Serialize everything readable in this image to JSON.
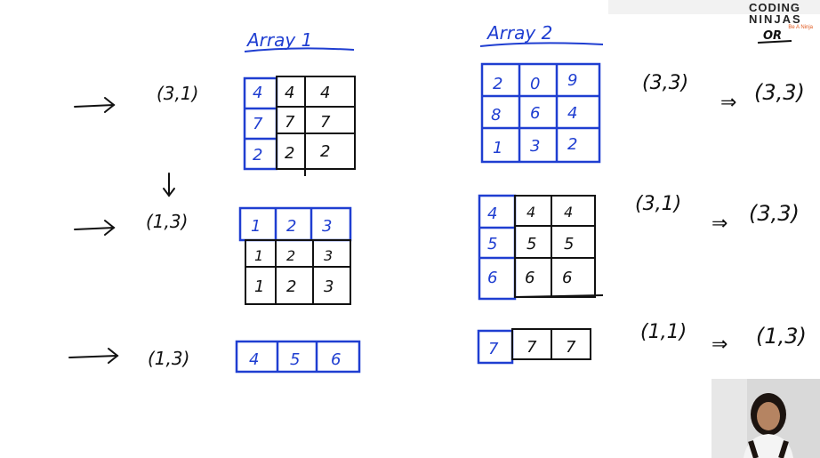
{
  "logo": {
    "line1": "CODING",
    "line2": "NINJAS",
    "tagline": "Be A Ninja"
  },
  "corner_note": "OR",
  "array1": {
    "title": "Array 1",
    "rows": [
      {
        "shape": "(3,1)",
        "ext": [
          "4",
          "7",
          "2"
        ],
        "grid": [
          [
            "4",
            "4"
          ],
          [
            "7",
            "7"
          ],
          [
            "2",
            "2"
          ]
        ]
      },
      {
        "shape": "(1,3)",
        "ext": [
          "1",
          "2",
          "3"
        ],
        "grid": [
          [
            "1",
            "2",
            "3"
          ],
          [
            "1",
            "2",
            "3"
          ]
        ]
      },
      {
        "shape": "(1,3)",
        "cells": [
          "4",
          "5",
          "6"
        ]
      }
    ]
  },
  "array2": {
    "title": "Array 2",
    "grid1": [
      [
        "2",
        "0",
        "9"
      ],
      [
        "8",
        "6",
        "4"
      ],
      [
        "1",
        "3",
        "2"
      ]
    ],
    "grid2_ext": [
      "4",
      "5",
      "6"
    ],
    "grid2": [
      [
        "4",
        "4"
      ],
      [
        "5",
        "5"
      ],
      [
        "6",
        "6"
      ]
    ],
    "row3": [
      "7",
      "7",
      "7"
    ]
  },
  "results": [
    {
      "a": "(3,3)",
      "arrow": "⇒",
      "b": "(3,3)"
    },
    {
      "a": "(3,1)",
      "arrow": "⇒",
      "b": "(3,3)"
    },
    {
      "a": "(1,1)",
      "arrow": "⇒",
      "b": "(1,3)"
    }
  ],
  "colors": {
    "ink": "#111111",
    "blue": "#1f3ed1",
    "accent": "#e05a20"
  }
}
